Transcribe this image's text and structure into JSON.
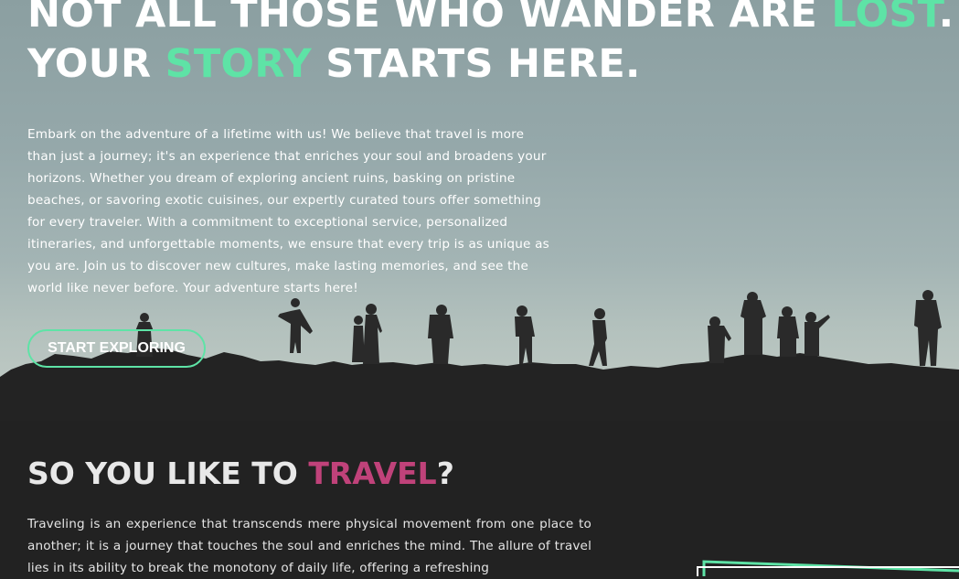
{
  "hero": {
    "headline_line1_prefix": "NOT ALL THOSE WHO WANDER ARE ",
    "headline_line1_accent": "LOST",
    "headline_line1_suffix": ".",
    "headline_line2_prefix": "YOUR ",
    "headline_line2_accent": "STORY",
    "headline_line2_suffix": " STARTS HERE.",
    "body": "Embark on the adventure of a lifetime with us! We believe that travel is more than just a journey; it's an experience that enriches your soul and broadens your horizons. Whether you dream of exploring ancient ruins, basking on pristine beaches, or savoring exotic cuisines, our expertly curated tours offer something for every traveler. With a commitment to exceptional service, personalized itineraries, and unforgettable moments, we ensure that every trip is as unique as you are. Join us to discover new cultures, make lasting memories, and see the world like never before. Your adventure starts here!",
    "cta_label": "START EXPLORING"
  },
  "travel_section": {
    "title_prefix": "SO YOU LIKE TO ",
    "title_accent": "TRAVEL",
    "title_suffix": "?",
    "body": "Traveling is an experience that transcends mere physical movement from one place to another; it is a journey that touches the soul and enriches the mind. The allure of travel lies in its ability to break the monotony of daily life, offering a refreshing"
  },
  "colors": {
    "accent_green": "#5ee3a6",
    "accent_pink": "#c0427a",
    "dark_background": "#222222"
  },
  "hero_image": "silhouettes-of-people-walking-on-hill"
}
